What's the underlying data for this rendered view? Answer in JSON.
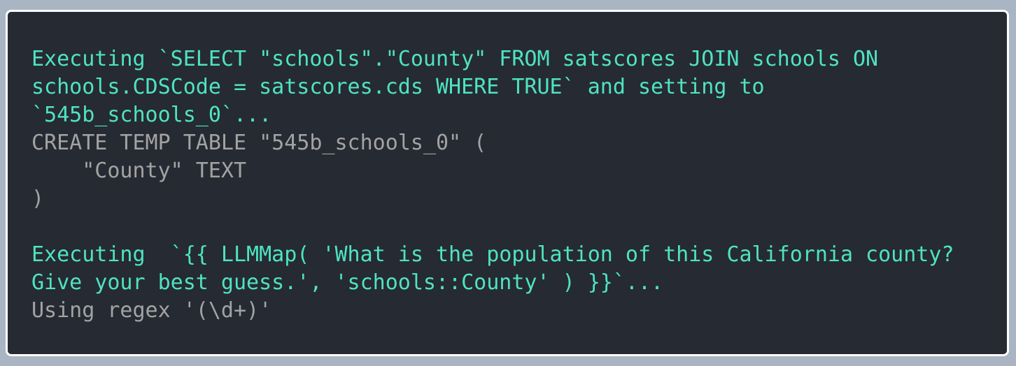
{
  "colors": {
    "page_background": "#a9b5c3",
    "terminal_background": "#262a33",
    "terminal_border": "#ffffff",
    "accent_text": "#4fe3c1",
    "muted_text": "#a3a3a3"
  },
  "terminal": {
    "lines": [
      {
        "text": "Executing `SELECT \"schools\".\"County\" FROM satscores JOIN schools ON",
        "style": "accent"
      },
      {
        "text": "schools.CDSCode = satscores.cds WHERE TRUE` and setting to",
        "style": "accent"
      },
      {
        "text": "`545b_schools_0`...",
        "style": "accent"
      },
      {
        "text": "CREATE TEMP TABLE \"545b_schools_0\" (",
        "style": "muted"
      },
      {
        "text": "    \"County\" TEXT",
        "style": "muted"
      },
      {
        "text": ")",
        "style": "muted"
      },
      {
        "text": "",
        "style": "muted"
      },
      {
        "text": "Executing  `{{ LLMMap( 'What is the population of this California county?",
        "style": "accent"
      },
      {
        "text": "Give your best guess.', 'schools::County' ) }}`...",
        "style": "accent"
      },
      {
        "text": "Using regex '(\\d+)'",
        "style": "muted"
      }
    ]
  }
}
